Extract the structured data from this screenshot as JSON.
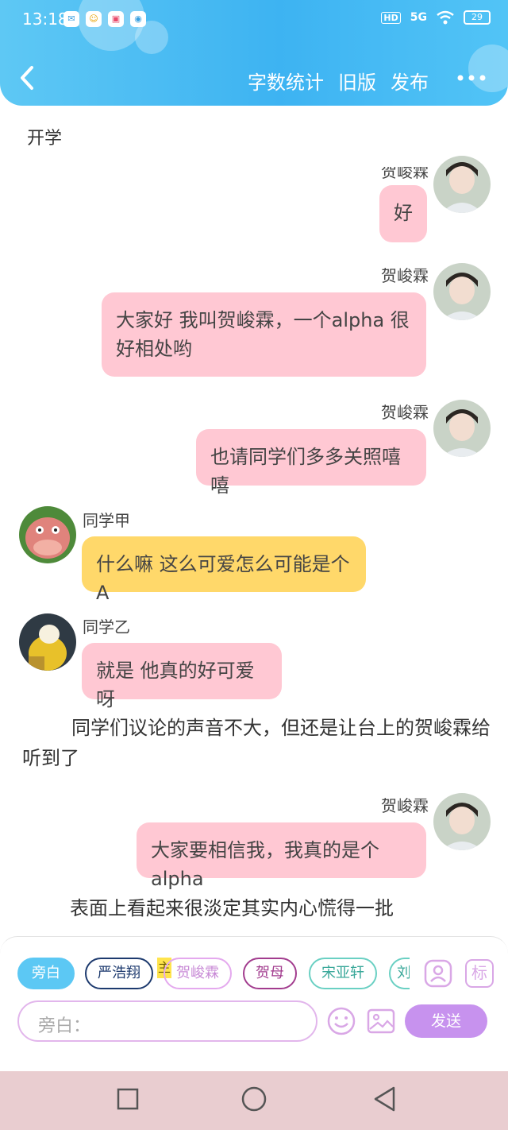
{
  "status_bar": {
    "time": "13:18",
    "network": "5G",
    "battery": "29"
  },
  "header": {
    "actions": [
      "字数统计",
      "旧版",
      "发布"
    ]
  },
  "scene_title": "开学",
  "messages": [
    {
      "name": "贺峻霖",
      "text": "好"
    },
    {
      "name": "贺峻霖",
      "text": "大家好 我叫贺峻霖，一个alpha 很好相处哟"
    },
    {
      "name": "贺峻霖",
      "text": "也请同学们多多关照嘻嘻"
    },
    {
      "name": "同学甲",
      "text": "什么嘛 这么可爱怎么可能是个A"
    },
    {
      "name": "同学乙",
      "text": "就是 他真的好可爱呀"
    },
    {
      "name": "贺峻霖",
      "text": "大家要相信我，我真的是个alpha"
    }
  ],
  "narrations": [
    "同学们议论的声音不大，但还是让台上的贺峻霖给听到了",
    "表面上看起来很淡定其实内心慌得一批"
  ],
  "input_panel": {
    "chips": [
      "旁白",
      "严浩翔",
      "贺峻霖",
      "贺母",
      "宋亚轩",
      "刘"
    ],
    "host_tag": "主",
    "tag_icon_label": "标",
    "input_placeholder": "旁白：",
    "send_label": "发送"
  },
  "colors": {
    "header": "#3db3f2",
    "pink_bubble": "#ffc8d3",
    "yellow_bubble": "#ffd86a",
    "send": "#c792ee"
  }
}
